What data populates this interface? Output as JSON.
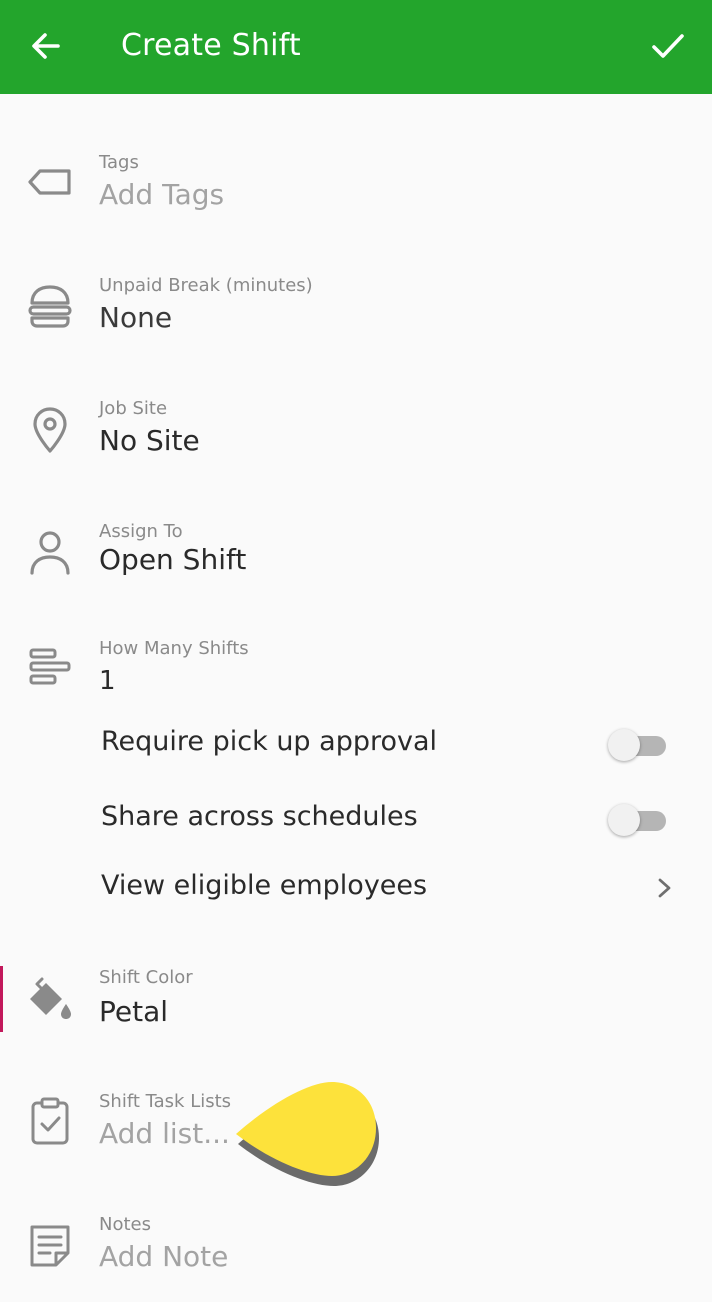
{
  "appbar": {
    "title": "Create Shift",
    "back_icon": "arrow-left-icon",
    "confirm_icon": "checkmark-icon",
    "color": "#23a52c"
  },
  "fields": {
    "tags": {
      "label": "Tags",
      "value": "Add Tags",
      "icon": "tag-icon"
    },
    "unpaid_break": {
      "label": "Unpaid Break (minutes)",
      "value": "None",
      "icon": "burger-icon"
    },
    "job_site": {
      "label": "Job Site",
      "value": "No Site",
      "icon": "location-pin-icon"
    },
    "assign_to": {
      "label": "Assign To",
      "value": "Open Shift",
      "icon": "person-icon"
    },
    "how_many": {
      "label": "How Many Shifts",
      "value": "1",
      "icon": "shift-bars-icon"
    },
    "shift_color": {
      "label": "Shift Color",
      "value": "Petal",
      "icon": "paint-bucket-icon",
      "accent": "#c2185b"
    },
    "task_lists": {
      "label": "Shift Task Lists",
      "value": "Add list...",
      "icon": "clipboard-check-icon"
    },
    "notes": {
      "label": "Notes",
      "value": "Add Note",
      "icon": "note-icon"
    }
  },
  "options": {
    "pickup_approval": {
      "label": "Require pick up approval",
      "enabled": false
    },
    "share_schedules": {
      "label": "Share across schedules",
      "enabled": false
    },
    "eligible": {
      "label": "View eligible employees",
      "icon": "chevron-right-icon"
    }
  },
  "pointer": {
    "icon": "teardrop-pointer-icon",
    "color": "#fde23b"
  }
}
